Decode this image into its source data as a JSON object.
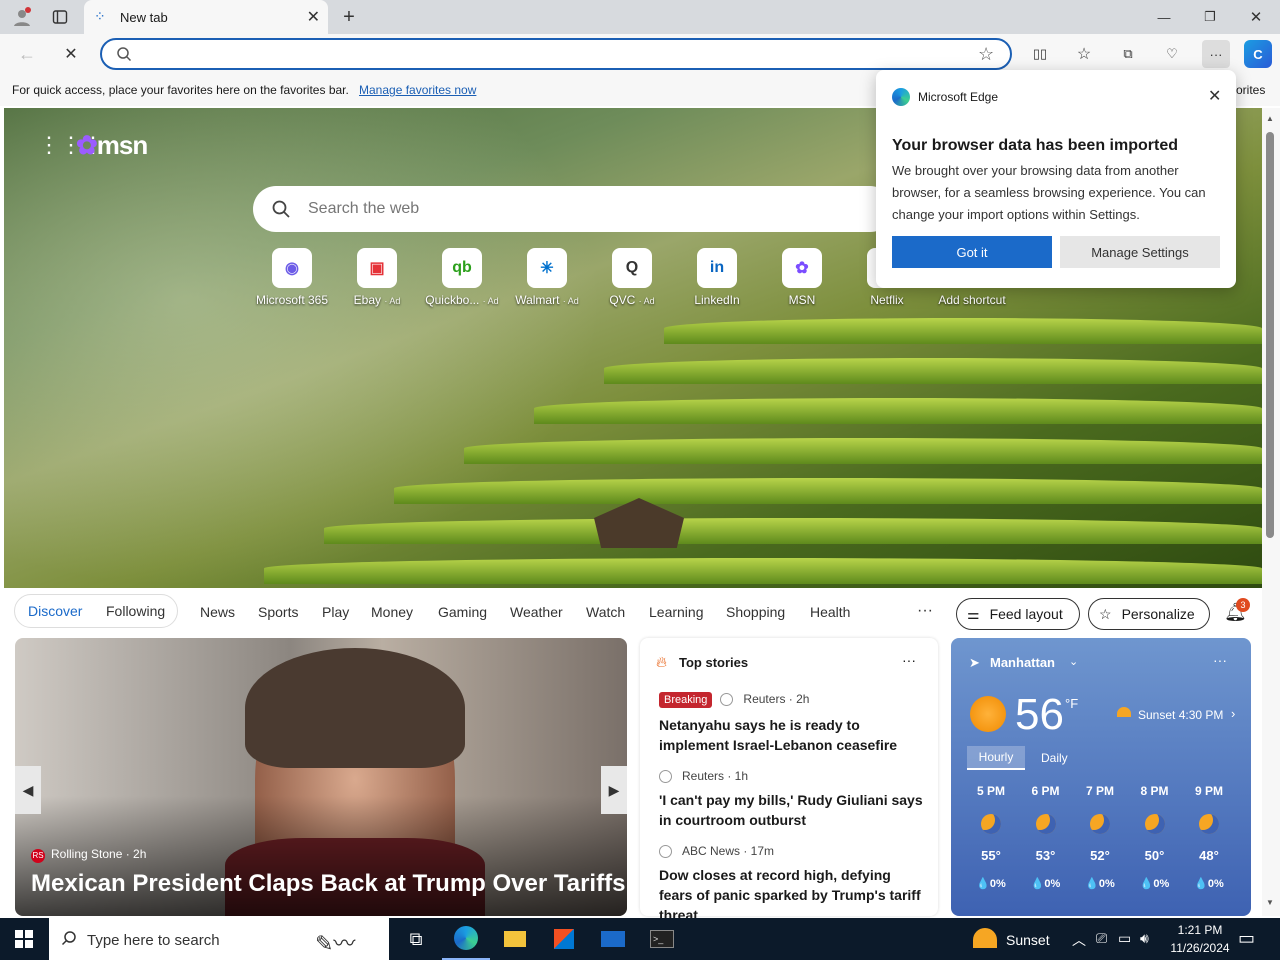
{
  "tab": {
    "title": "New tab"
  },
  "address": {
    "value": "",
    "placeholder": ""
  },
  "favbar": {
    "text": "For quick access, place your favorites here on the favorites bar.",
    "link": "Manage favorites now",
    "right_text": "orites"
  },
  "msn": {
    "logo": "msn",
    "search_placeholder": "Search the web"
  },
  "shortcuts": [
    {
      "label": "Microsoft 365",
      "ad": "",
      "glyph": "◉",
      "color": "#6c5ce7"
    },
    {
      "label": "Ebay",
      "ad": "· Ad",
      "glyph": "▣",
      "color": "#e53238"
    },
    {
      "label": "Quickbo...",
      "ad": "· Ad",
      "glyph": "qb",
      "color": "#2ca01c"
    },
    {
      "label": "Walmart",
      "ad": "· Ad",
      "glyph": "✳",
      "color": "#0071ce"
    },
    {
      "label": "QVC",
      "ad": "· Ad",
      "glyph": "Q",
      "color": "#333333"
    },
    {
      "label": "LinkedIn",
      "ad": "",
      "glyph": "in",
      "color": "#0a66c2"
    },
    {
      "label": "MSN",
      "ad": "",
      "glyph": "✿",
      "color": "#7b4dff"
    },
    {
      "label": "Netflix",
      "ad": "",
      "glyph": "",
      "color": "#e50914"
    },
    {
      "label": "Add shortcut",
      "ad": "",
      "glyph": "",
      "color": "#ffffff"
    }
  ],
  "popup": {
    "brand": "Microsoft Edge",
    "heading": "Your browser data has been imported",
    "body": "We brought over your browsing data from another browser, for a seamless browsing experience. You can change your import options within Settings.",
    "primary": "Got it",
    "secondary": "Manage Settings"
  },
  "feednav": {
    "discover": "Discover",
    "following": "Following",
    "items": [
      "News",
      "Sports",
      "Play",
      "Money",
      "Gaming",
      "Weather",
      "Watch",
      "Learning",
      "Shopping",
      "Health"
    ],
    "more": "···",
    "feed_layout": "Feed layout",
    "personalize": "Personalize",
    "notifications": "3"
  },
  "lead": {
    "source": "Rolling Stone · 2h",
    "headline": "Mexican President Claps Back at Trump Over Tariffs"
  },
  "topstories": {
    "title": "Top stories",
    "items": [
      {
        "badge": "Breaking",
        "meta": "Reuters · 2h",
        "title": "Netanyahu says he is ready to implement Israel-Lebanon ceasefire"
      },
      {
        "badge": "",
        "meta": "Reuters · 1h",
        "title": "'I can't pay my bills,' Rudy Giuliani says in courtroom outburst"
      },
      {
        "badge": "",
        "meta": "ABC News · 17m",
        "title": "Dow closes at record high, defying fears of panic sparked by Trump's tariff threat"
      }
    ]
  },
  "weather": {
    "location": "Manhattan",
    "temp": "56",
    "unit": "°F",
    "sunset": "Sunset 4:30 PM",
    "tab_hourly": "Hourly",
    "tab_daily": "Daily",
    "hours": [
      {
        "time": "5 PM",
        "temp": "55°",
        "precip": "💧0%"
      },
      {
        "time": "6 PM",
        "temp": "53°",
        "precip": "💧0%"
      },
      {
        "time": "7 PM",
        "temp": "52°",
        "precip": "💧0%"
      },
      {
        "time": "8 PM",
        "temp": "50°",
        "precip": "💧0%"
      },
      {
        "time": "9 PM",
        "temp": "48°",
        "precip": "💧0%"
      }
    ]
  },
  "taskbar": {
    "search_placeholder": "Type here to search",
    "weather": "Sunset",
    "time": "1:21 PM",
    "date": "11/26/2024"
  }
}
